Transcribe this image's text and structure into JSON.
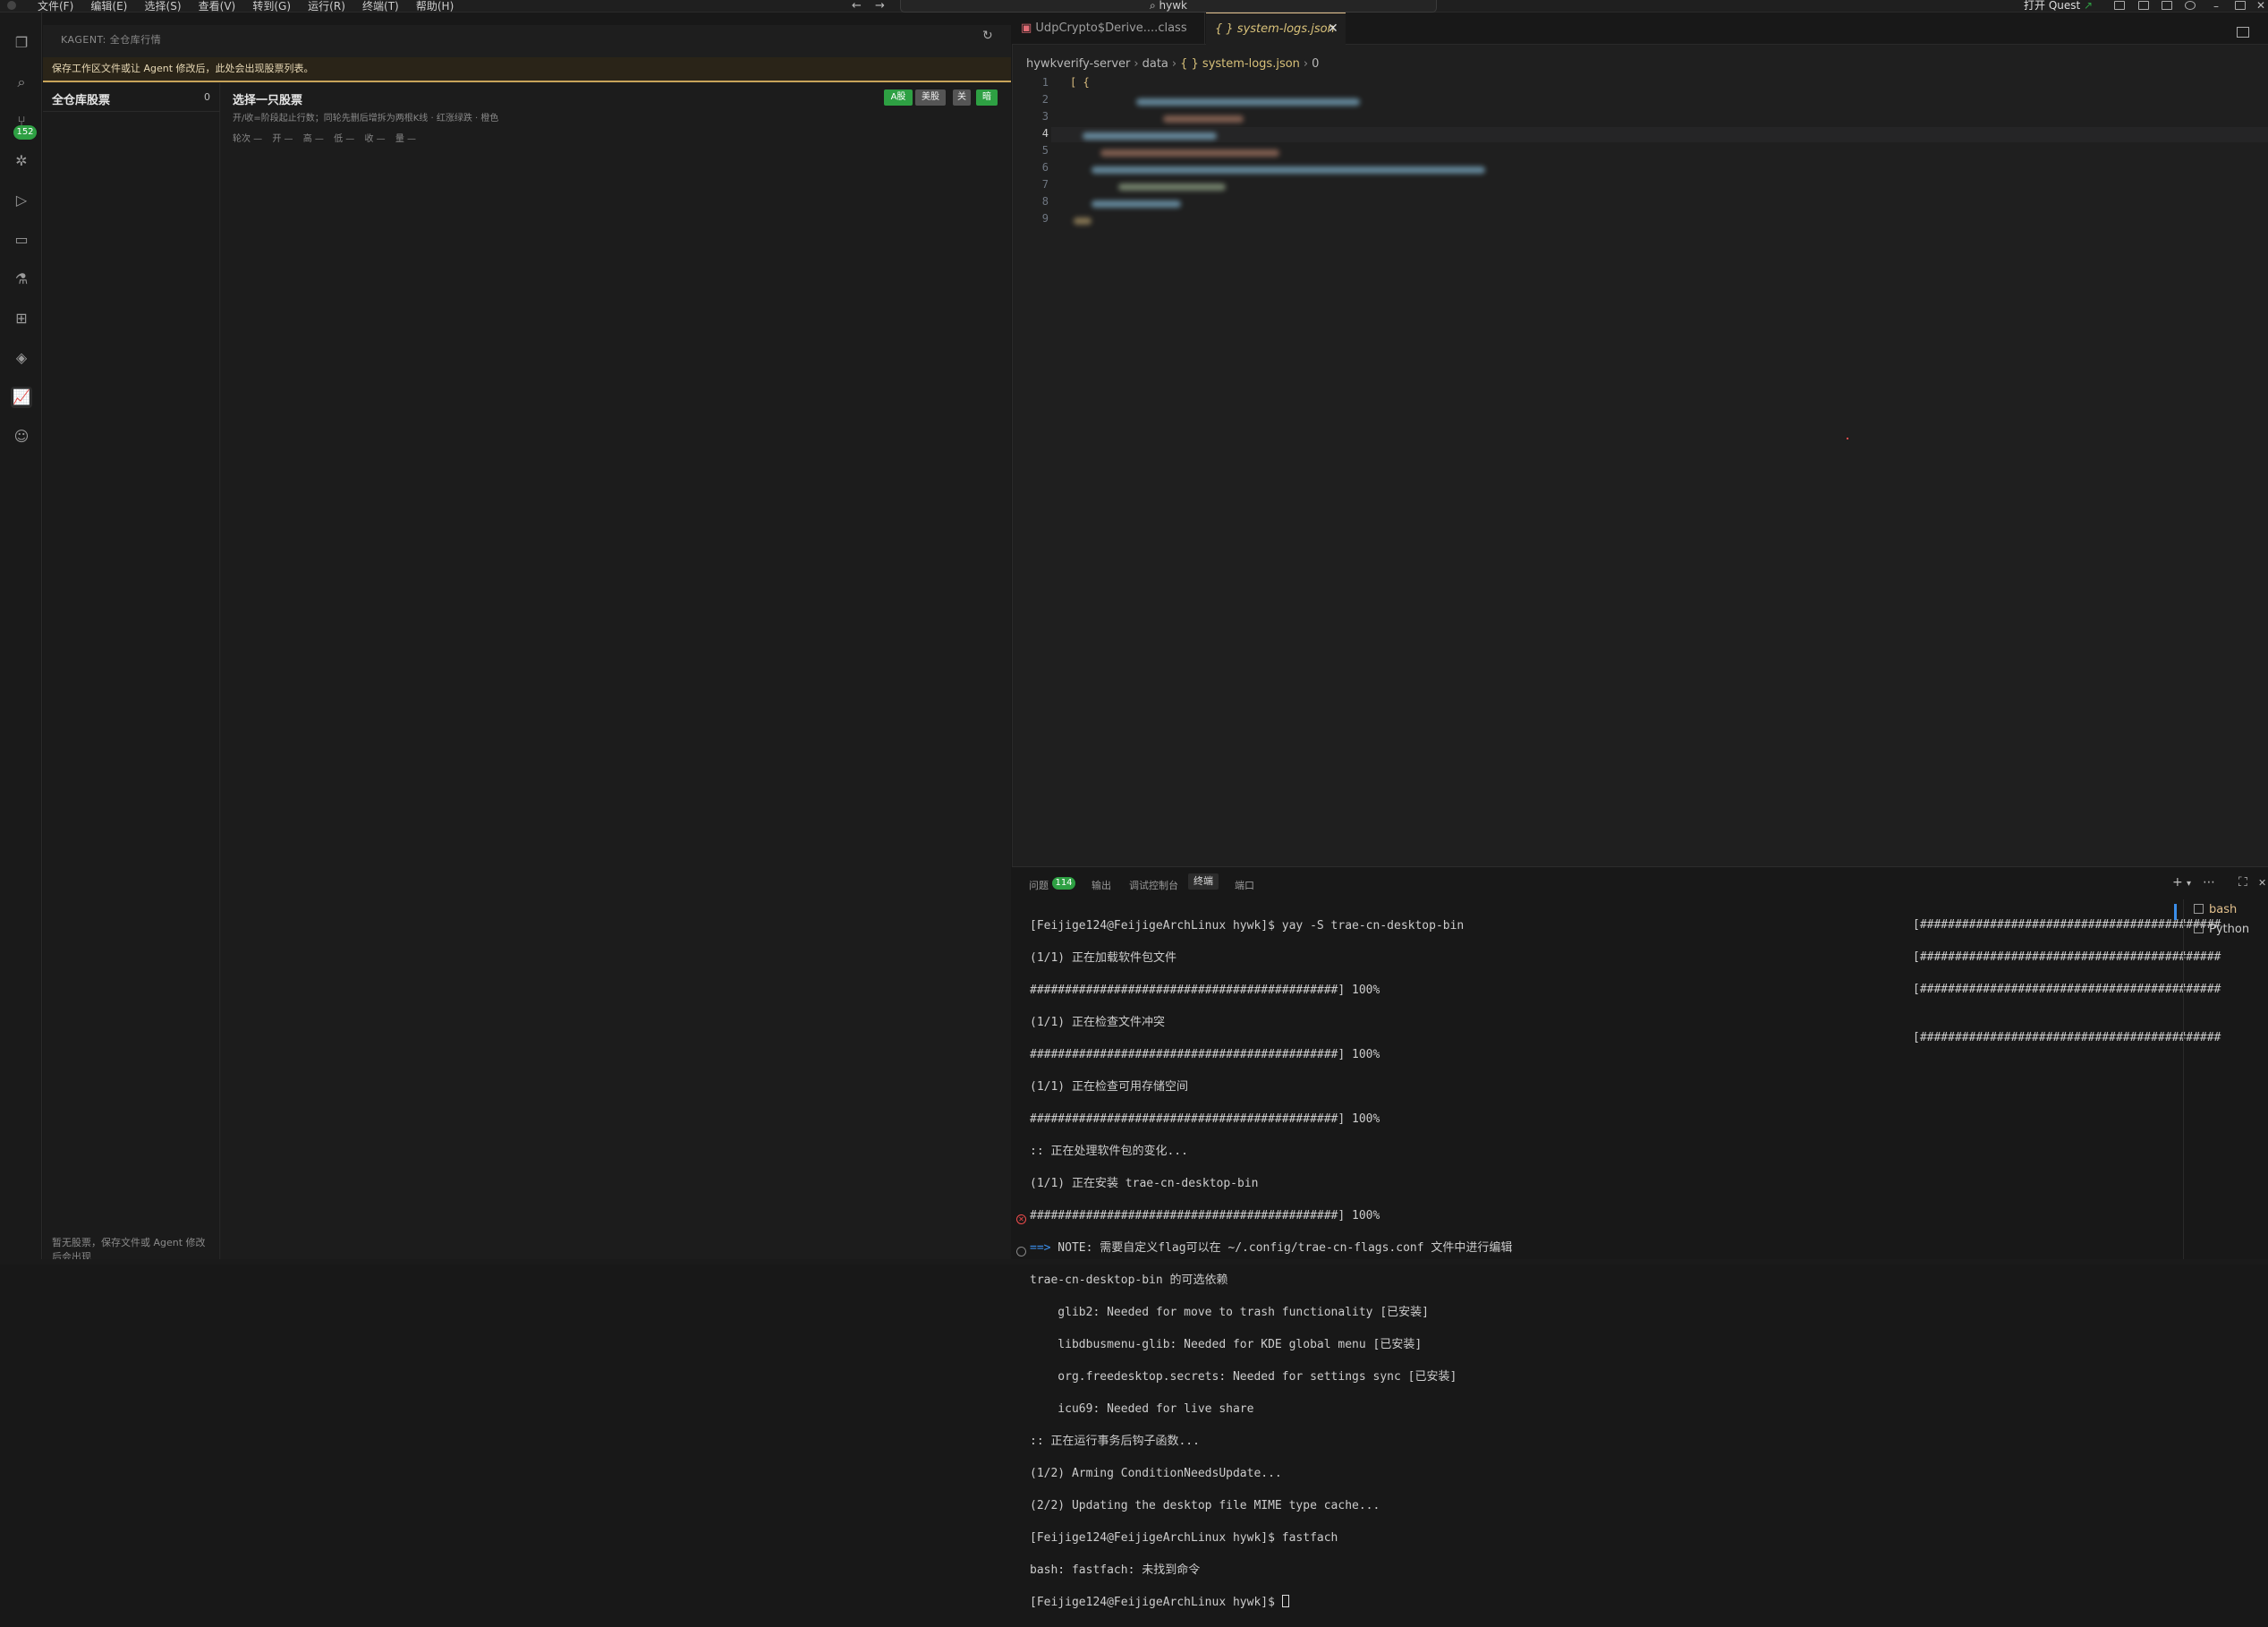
{
  "menubar": {
    "items": [
      "文件(F)",
      "编辑(E)",
      "选择(S)",
      "查看(V)",
      "转到(G)",
      "运行(R)",
      "终端(T)",
      "帮助(H)"
    ],
    "search": "hywk",
    "quest_label": "打开 Quest"
  },
  "activity_bar": {
    "icons": [
      "explorer-icon",
      "search-icon",
      "source-control-icon",
      "debug-icon",
      "run-icon",
      "remote-icon",
      "testing-icon",
      "extensions-icon",
      "packages-icon",
      "chart-icon",
      "accounts-icon"
    ],
    "scm_badge": "152"
  },
  "kagent": {
    "title": "KAGENT: 全仓库行情",
    "notice": "保存工作区文件或让 Agent 修改后，此处会出现股票列表。",
    "list_title": "全仓库股票",
    "list_count": "0",
    "list_footer": "暂无股票，保存文件或 Agent 修改后会出现",
    "detail_title": "选择一只股票",
    "detail_subtitle": "开/收=阶段起止行数；同轮先删后增拆为两根K线 · 红涨绿跌 · 橙色",
    "ohlc": [
      "轮次 —",
      "开 —",
      "高 —",
      "低 —",
      "收 —",
      "量 —"
    ],
    "pills": {
      "a": "A股",
      "us": "美股",
      "close": "关",
      "on": "暗"
    }
  },
  "editor": {
    "tabs": [
      {
        "label": "UdpCrypto$Derive....class",
        "active": false
      },
      {
        "label": "{ } system-logs.json",
        "active": true
      }
    ],
    "breadcrumb": [
      "hywkverify-server",
      "data",
      "{ } system-logs.json",
      "0"
    ],
    "line_numbers": [
      "1",
      "2",
      "3",
      "4",
      "5",
      "6",
      "7",
      "8",
      "9"
    ],
    "first_line": "[ {"
  },
  "panel": {
    "tabs": [
      "问题",
      "输出",
      "调试控制台",
      "终端",
      "端口"
    ],
    "problems_badge": "114",
    "active_tab": "终端",
    "terminal_lines": [
      "[Feijige124@FeijigeArchLinux hywk]$ yay -S trae-cn-desktop-bin",
      "(1/1) 正在加载软件包文件",
      "############################################] 100%",
      "(1/1) 正在检查文件冲突",
      "############################################] 100%",
      "(1/1) 正在检查可用存储空间",
      "############################################] 100%",
      ":: 正在处理软件包的变化...",
      "(1/1) 正在安装 trae-cn-desktop-bin",
      "############################################] 100%",
      "==> NOTE: 需要自定义flag可以在 ~/.config/trae-cn-flags.conf 文件中进行编辑",
      "trae-cn-desktop-bin 的可选依赖",
      "    glib2: Needed for move to trash functionality [已安装]",
      "    libdbusmenu-glib: Needed for KDE global menu [已安装]",
      "    org.freedesktop.secrets: Needed for settings sync [已安装]",
      "    icu69: Needed for live share",
      ":: 正在运行事务后钩子函数...",
      "(1/2) Arming ConditionNeedsUpdate...",
      "(2/2) Updating the desktop file MIME type cache...",
      "[Feijige124@FeijigeArchLinux hywk]$ fastfach",
      "bash: fastfach: 未找到命令",
      "[Feijige124@FeijigeArchLinux hywk]$ "
    ],
    "progress_right": "[###########################################",
    "terminals": [
      "bash",
      "Python"
    ]
  }
}
